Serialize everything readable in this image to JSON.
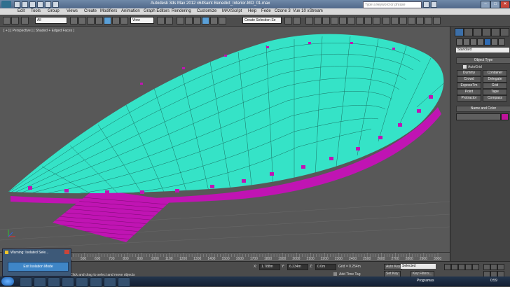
{
  "window": {
    "title": "Autodesk 3ds Max 2012 x64",
    "file": "Saint Benedict_Interior-MO_01.max",
    "search_placeholder": "Type a keyword or phrase",
    "controls": [
      "–",
      "□",
      "✕"
    ]
  },
  "menu": [
    "Edit",
    "Tools",
    "Group",
    "Views",
    "Create",
    "Modifiers",
    "Animation",
    "Graph Editors",
    "Rendering",
    "Customize",
    "MAXScript",
    "Help",
    "Fede",
    "Ozone 3",
    "Vue 10 xStream"
  ],
  "toolbar": {
    "selection_filter": "All",
    "reference_coord": "View",
    "named_selection": "Create Selection Se"
  },
  "viewport": {
    "label": "[ + ] [ Perspective ] [ Shaded + Edged Faces ]",
    "colors": {
      "object": "#35e3c7",
      "base": "#c014b3",
      "wire": "#1a6f62",
      "background": "#585858"
    }
  },
  "command_panel": {
    "category_dropdown": "Standard",
    "object_type_title": "Object Type",
    "autogrid_label": "AutoGrid",
    "buttons": [
      "Dummy",
      "Container",
      "Crowd",
      "Delegate",
      "ExposeTm",
      "Grid",
      "Point",
      "Tape",
      "Protractor",
      "Compass"
    ],
    "name_color_title": "Name and Color",
    "swatch_color": "#c0139b"
  },
  "timeline": {
    "ticks": [
      "0",
      "100",
      "200",
      "300",
      "400",
      "500",
      "600",
      "700",
      "800",
      "900",
      "1000",
      "1100",
      "1200",
      "1300",
      "1400",
      "1500",
      "1600",
      "1700",
      "1800",
      "1900",
      "2000",
      "2100",
      "2200",
      "2300",
      "2400",
      "2500",
      "2600",
      "2700",
      "2800",
      "2900",
      "3000"
    ]
  },
  "status": {
    "prompt": "Click and drag to select and move objects",
    "x_label": "X:",
    "x": "1.788m",
    "y_label": "Y:",
    "y": "6.234m",
    "z_label": "Z:",
    "z": "0.0m",
    "grid": "Grid = 0.254m",
    "auto_key": "Auto Key",
    "set_key": "Set Key",
    "key_mode": "Selected",
    "key_filters": "Key Filters...",
    "add_time_tag": "Add Time Tag"
  },
  "warning": {
    "title": "Warning: Isolated Sele...",
    "button": "Exit Isolation Mode"
  },
  "taskbar": {
    "tray": "Programas",
    "clock": "0:59"
  }
}
